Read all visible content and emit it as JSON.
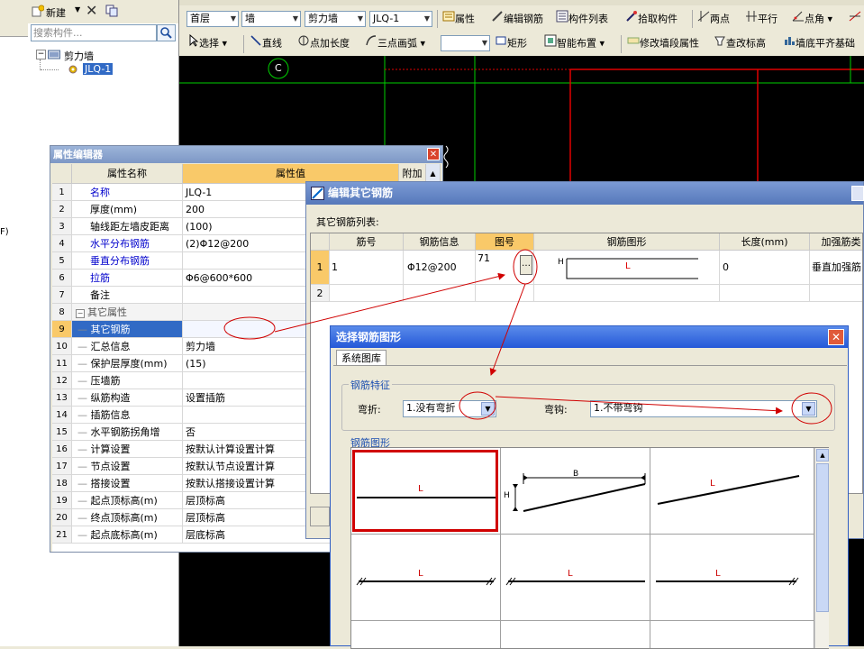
{
  "left_strip": {
    "fragment": "F)"
  },
  "tree": {
    "new_label": "新建",
    "search_placeholder": "搜索构件...",
    "root_label": "剪力墙",
    "child_label": "JLQ-1"
  },
  "toolbar1": {
    "floor": "首层",
    "type": "墙",
    "subtype": "剪力墙",
    "component": "JLQ-1",
    "properties": "属性",
    "edit_rebar": "编辑钢筋",
    "component_list": "构件列表",
    "pick": "拾取构件",
    "two_points": "两点",
    "parallel": "平行",
    "point_angle": "点角"
  },
  "toolbar2": {
    "select": "选择",
    "line": "直线",
    "point_length": "点加长度",
    "three_point_arc": "三点画弧",
    "rectangle": "矩形",
    "smart_layout": "智能布置",
    "modify_wall_props": "修改墙段属性",
    "check_elevation": "查改标高",
    "wall_bottom_align": "墙底平齐基础"
  },
  "canvas": {
    "axis_label": "C"
  },
  "property_editor": {
    "title": "属性编辑器",
    "col_name": "属性名称",
    "col_value": "属性值",
    "col_extra": "附加",
    "group_label": "其它属性",
    "rows": [
      {
        "n": "1",
        "name": "名称",
        "value": "JLQ-1"
      },
      {
        "n": "2",
        "name": "厚度(mm)",
        "value": "200"
      },
      {
        "n": "3",
        "name": "轴线距左墙皮距离",
        "value": "(100)"
      },
      {
        "n": "4",
        "name": "水平分布钢筋",
        "value": "(2)Φ12@200"
      },
      {
        "n": "5",
        "name": "垂直分布钢筋",
        "value": ""
      },
      {
        "n": "6",
        "name": "拉筋",
        "value": "Φ6@600*600"
      },
      {
        "n": "7",
        "name": "备注",
        "value": ""
      },
      {
        "n": "8",
        "name": "",
        "value": ""
      },
      {
        "n": "9",
        "name": "其它钢筋",
        "value": ""
      },
      {
        "n": "10",
        "name": "汇总信息",
        "value": "剪力墙"
      },
      {
        "n": "11",
        "name": "保护层厚度(mm)",
        "value": "(15)"
      },
      {
        "n": "12",
        "name": "压墙筋",
        "value": ""
      },
      {
        "n": "13",
        "name": "纵筋构造",
        "value": "设置插筋"
      },
      {
        "n": "14",
        "name": "插筋信息",
        "value": ""
      },
      {
        "n": "15",
        "name": "水平钢筋拐角增",
        "value": "否"
      },
      {
        "n": "16",
        "name": "计算设置",
        "value": "按默认计算设置计算"
      },
      {
        "n": "17",
        "name": "节点设置",
        "value": "按默认节点设置计算"
      },
      {
        "n": "18",
        "name": "搭接设置",
        "value": "按默认搭接设置计算"
      },
      {
        "n": "19",
        "name": "起点顶标高(m)",
        "value": "层顶标高"
      },
      {
        "n": "20",
        "name": "终点顶标高(m)",
        "value": "层顶标高"
      },
      {
        "n": "21",
        "name": "起点底标高(m)",
        "value": "层底标高"
      }
    ]
  },
  "edit_rebar": {
    "title": "编辑其它钢筋",
    "list_label": "其它钢筋列表:",
    "cols": [
      "筋号",
      "钢筋信息",
      "图号",
      "钢筋图形",
      "长度(mm)",
      "加强筋类"
    ],
    "row1": {
      "n": "1",
      "bar_no": "1",
      "info": "Φ12@200",
      "shape_no": "71",
      "len": "0",
      "type": "垂直加强筋"
    },
    "row2": {
      "n": "2"
    },
    "shape_h": "H",
    "shape_l": "L"
  },
  "select_shape": {
    "title": "选择钢筋图形",
    "tab": "系统图库",
    "feature_group": "钢筋特征",
    "bend_label": "弯折:",
    "bend_value": "1.没有弯折",
    "hook_label": "弯钩:",
    "hook_value": "1.不带弯钩",
    "shape_group": "钢筋图形",
    "labels": {
      "L": "L",
      "B": "B",
      "H": "H"
    }
  }
}
